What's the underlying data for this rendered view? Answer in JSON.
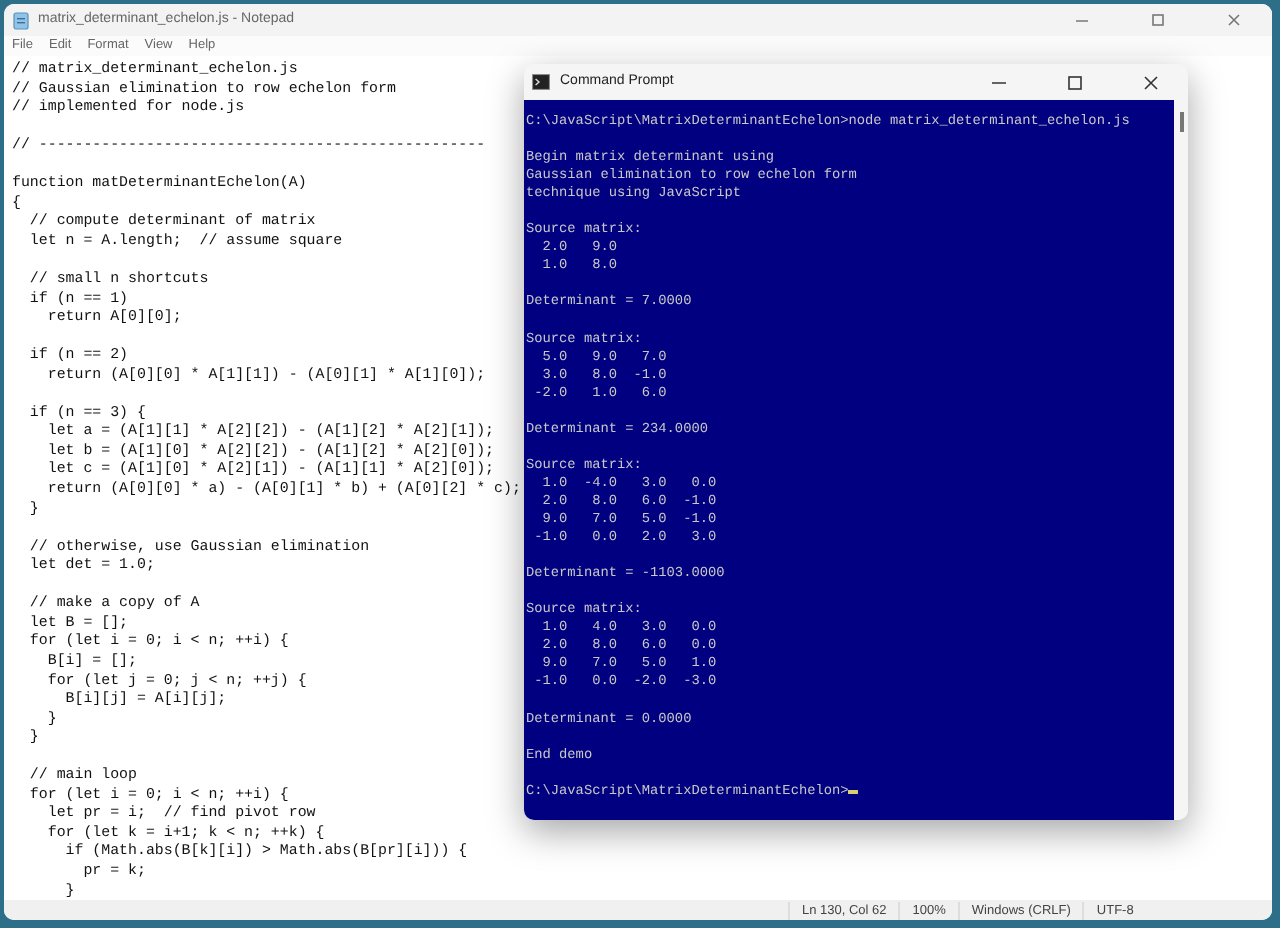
{
  "notepad": {
    "title": "matrix_determinant_echelon.js - Notepad",
    "menu": [
      "File",
      "Edit",
      "Format",
      "View",
      "Help"
    ],
    "code_blocks": [
      [
        "// matrix_determinant_echelon.js",
        "// Gaussian elimination to row echelon form",
        "// implemented for node.js"
      ],
      [
        "// --------------------------------------------------"
      ],
      [
        "function matDeterminantEchelon(A)",
        "{",
        "  // compute determinant of matrix",
        "  let n = A.length;  // assume square"
      ],
      [
        "  // small n shortcuts",
        "  if (n == 1)",
        "    return A[0][0];"
      ],
      [
        "  if (n == 2)",
        "    return (A[0][0] * A[1][1]) - (A[0][1] * A[1][0]);"
      ],
      [
        "  if (n == 3) {",
        "    let a = (A[1][1] * A[2][2]) - (A[1][2] * A[2][1]);",
        "    let b = (A[1][0] * A[2][2]) - (A[1][2] * A[2][0]);",
        "    let c = (A[1][0] * A[2][1]) - (A[1][1] * A[2][0]);",
        "    return (A[0][0] * a) - (A[0][1] * b) + (A[0][2] * c);",
        "  }"
      ],
      [
        "  // otherwise, use Gaussian elimination",
        "  let det = 1.0;"
      ],
      [
        "  // make a copy of A",
        "  let B = [];",
        "  for (let i = 0; i < n; ++i) {",
        "    B[i] = [];",
        "    for (let j = 0; j < n; ++j) {",
        "      B[i][j] = A[i][j];",
        "    }",
        "  }"
      ],
      [
        "  // main loop",
        "  for (let i = 0; i < n; ++i) {",
        "    let pr = i;  // find pivot row",
        "    for (let k = i+1; k < n; ++k) {",
        "      if (Math.abs(B[k][i]) > Math.abs(B[pr][i])) {",
        "        pr = k;",
        "      }"
      ]
    ],
    "status": [
      "Ln 130, Col 62",
      "100%",
      "Windows (CRLF)",
      "UTF-8"
    ]
  },
  "command_prompt": {
    "title": "Command Prompt",
    "blocks": [
      [
        "C:\\JavaScript\\MatrixDeterminantEchelon>node matrix_determinant_echelon.js"
      ],
      [
        "Begin matrix determinant using",
        "Gaussian elimination to row echelon form",
        "technique using JavaScript"
      ],
      [
        "Source matrix:",
        "  2.0   9.0",
        "  1.0   8.0"
      ],
      [
        "Determinant = 7.0000"
      ],
      [
        "Source matrix:",
        "  5.0   9.0   7.0",
        "  3.0   8.0  -1.0",
        " -2.0   1.0   6.0"
      ],
      [
        "Determinant = 234.0000"
      ],
      [
        "Source matrix:",
        "  1.0  -4.0   3.0   0.0",
        "  2.0   8.0   6.0  -1.0",
        "  9.0   7.0   5.0  -1.0",
        " -1.0   0.0   2.0   3.0"
      ],
      [
        "Determinant = -1103.0000"
      ],
      [
        "Source matrix:",
        "  1.0   4.0   3.0   0.0",
        "  2.0   8.0   6.0   0.0",
        "  9.0   7.0   5.0   1.0",
        " -1.0   0.0  -2.0  -3.0"
      ],
      [
        "Determinant = 0.0000"
      ],
      [
        "End demo"
      ],
      [
        "C:\\JavaScript\\MatrixDeterminantEchelon>"
      ]
    ]
  }
}
